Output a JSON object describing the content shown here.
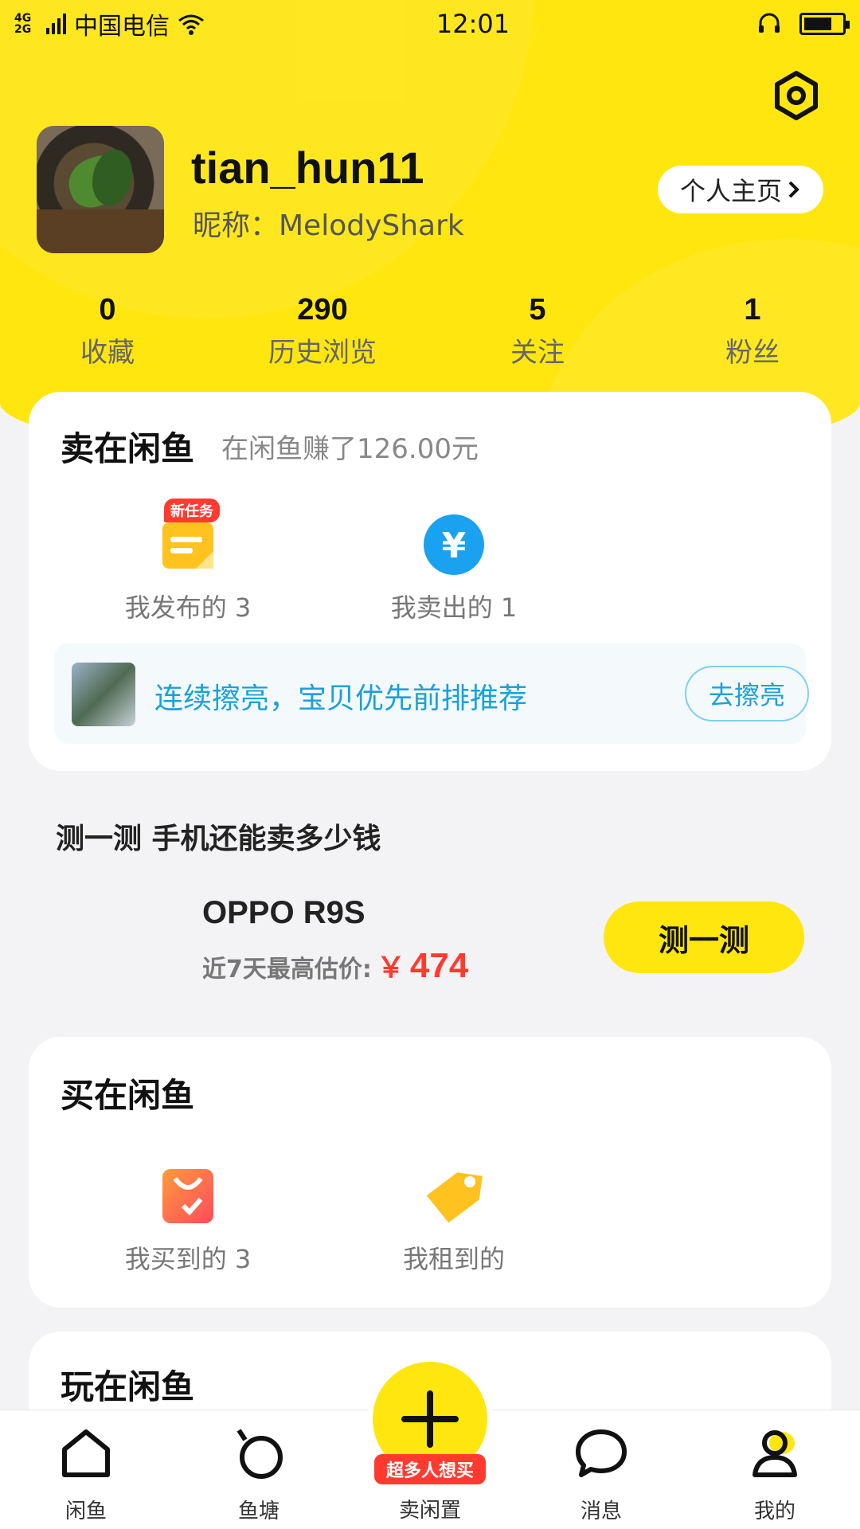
{
  "status_bar": {
    "network_type": "4G\n2G",
    "carrier": "中国电信",
    "time": "12:01",
    "battery_level": 0.6
  },
  "header": {
    "settings_icon": "gear-hexagon-icon",
    "username": "tian_hun11",
    "nickname": "昵称：MelodyShark",
    "homepage_label": "个人主页"
  },
  "stats": [
    {
      "value": "0",
      "label": "收藏"
    },
    {
      "value": "290",
      "label": "历史浏览"
    },
    {
      "value": "5",
      "label": "关注"
    },
    {
      "value": "1",
      "label": "粉丝"
    }
  ],
  "sell_card": {
    "title": "卖在闲鱼",
    "subtitle": "在闲鱼赚了126.00元",
    "items": [
      {
        "label": "我发布的 3",
        "badge": "新任务",
        "icon": "published-icon"
      },
      {
        "label": "我卖出的 1",
        "icon": "yuan-icon"
      }
    ],
    "promo": {
      "text": "连续擦亮，宝贝优先前排推荐",
      "button": "去擦亮"
    }
  },
  "estimate": {
    "title": "测一测 手机还能卖多少钱",
    "model": "OPPO R9S",
    "price_label": "近7天最高估价:",
    "currency": "￥",
    "price": "474",
    "button": "测一测"
  },
  "buy_card": {
    "title": "买在闲鱼",
    "items": [
      {
        "label": "我买到的 3",
        "icon": "shopping-bag-icon"
      },
      {
        "label": "我租到的",
        "icon": "rental-tag-icon"
      }
    ]
  },
  "play_card": {
    "title": "玩在闲鱼"
  },
  "bottom_nav": {
    "items": [
      {
        "label": "闲鱼",
        "icon": "home-icon"
      },
      {
        "label": "鱼塘",
        "icon": "pond-icon"
      },
      {
        "label": "卖闲置",
        "icon": "plus-icon",
        "badge": "超多人想买"
      },
      {
        "label": "消息",
        "icon": "message-icon"
      },
      {
        "label": "我的",
        "icon": "profile-icon"
      }
    ]
  },
  "colors": {
    "accent": "#ffe60f",
    "price_red": "#ff3b30",
    "link_blue": "#1aa1d8"
  }
}
